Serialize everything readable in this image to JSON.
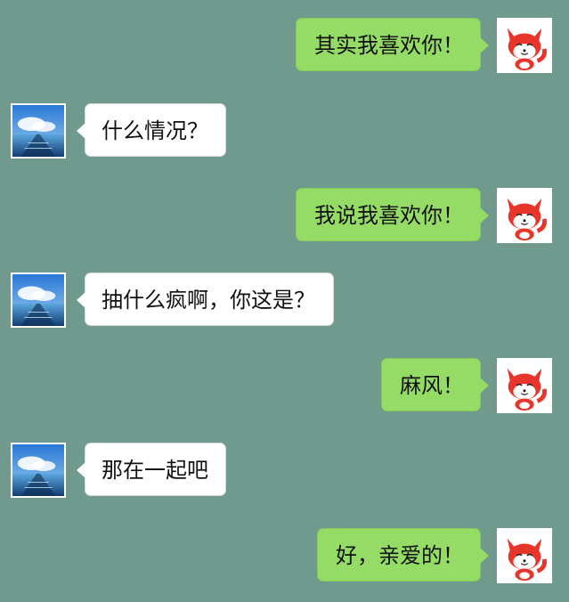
{
  "messages": [
    {
      "side": "right",
      "text": "其实我喜欢你！",
      "avatar": "fox-avatar"
    },
    {
      "side": "left",
      "text": "什么情况？",
      "avatar": "sky-sea-avatar"
    },
    {
      "side": "right",
      "text": "我说我喜欢你！",
      "avatar": "fox-avatar"
    },
    {
      "side": "left",
      "text": "抽什么疯啊，你这是？",
      "avatar": "sky-sea-avatar"
    },
    {
      "side": "right",
      "text": "麻风！",
      "avatar": "fox-avatar"
    },
    {
      "side": "left",
      "text": "那在一起吧",
      "avatar": "sky-sea-avatar"
    },
    {
      "side": "right",
      "text": "好，亲爱的！",
      "avatar": "fox-avatar"
    }
  ],
  "colors": {
    "background": "#6f9a8d",
    "outgoing_bubble": "#95dc66",
    "incoming_bubble": "#ffffff"
  }
}
